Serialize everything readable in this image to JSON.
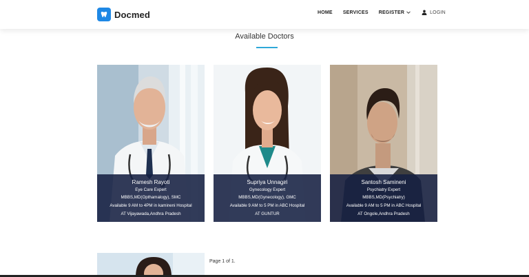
{
  "header": {
    "brand": "Docmed",
    "nav": [
      {
        "label": "HOME"
      },
      {
        "label": "SERVICES"
      },
      {
        "label": "REGISTER"
      },
      {
        "label": "LOGIN"
      }
    ]
  },
  "section": {
    "title": "Available Doctors"
  },
  "doctors": [
    {
      "name": "Ramesh Rayoti",
      "specialty": "Eye Care Expert",
      "qualification": "MBBS,MD(Opthamalogy), SMC",
      "availability": "Available 9 AM to 4PM in kamineni Hospital",
      "location": "AT Vijayawada,Andhra Pradesh"
    },
    {
      "name": "Supriya Unnagiri",
      "specialty": "Gynecology Expert",
      "qualification": "MBBS,MD(Gynecology), GMC",
      "availability": "Available 9 AM to 5 PM in ABC Hospital",
      "location": "AT GUNTUR"
    },
    {
      "name": "Santosh Samineni",
      "specialty": "Psychiatry Expert",
      "qualification": "MBBS,MD(Psychiatry)",
      "availability": "Available 9 AM to 5 PM in ABC Hospital",
      "location": "AT Ongole,Andhra Pradesh"
    }
  ],
  "pagination": {
    "text": "Page 1 of 1."
  },
  "colors": {
    "accent": "#2ea8d8",
    "brand_logo": "#1e88e5",
    "card_overlay": "#162042"
  },
  "icons": {
    "brand": "tooth-logo-icon",
    "register_dropdown": "chevron-down-icon",
    "login": "user-icon"
  }
}
